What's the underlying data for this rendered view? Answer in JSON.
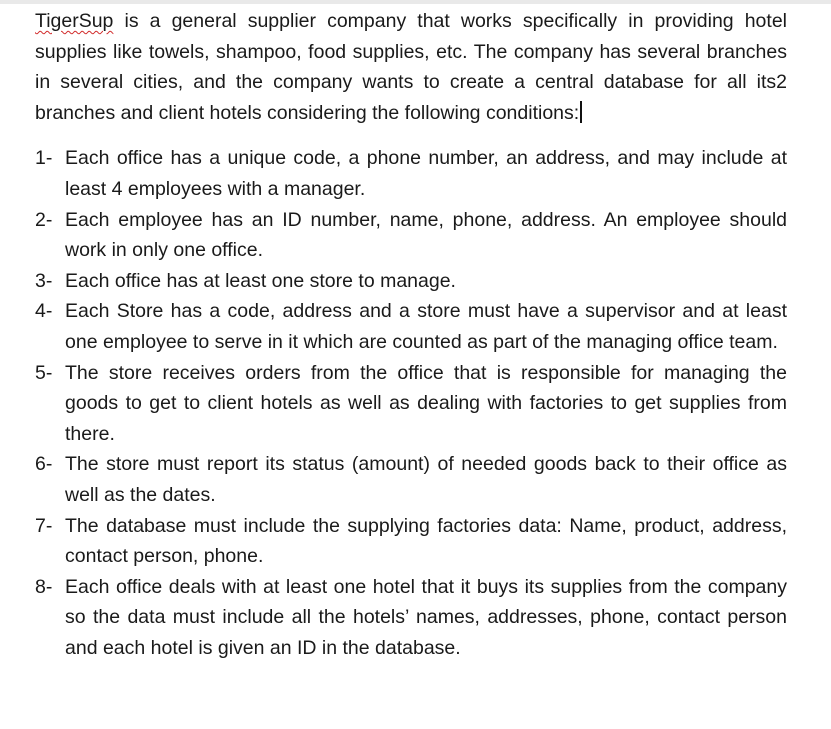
{
  "intro": {
    "brand": "TigerSup",
    "rest": " is a general supplier company that works specifically in providing hotel supplies like towels, shampoo, food supplies, etc. The company has several branches in several cities, and the company wants to create a central database for all its2 branches and client hotels considering the following conditions:"
  },
  "conditions": [
    {
      "num": "1-",
      "text": "Each office has a unique code, a phone number, an address, and may include at least 4 employees with a manager."
    },
    {
      "num": "2-",
      "text": "Each employee has an ID number, name, phone, address. An employee should work in only one office."
    },
    {
      "num": "3-",
      "text": "Each office has at least one store to manage."
    },
    {
      "num": "4-",
      "text": "Each Store has a code, address and a store must have a supervisor and at least one employee to serve in it which are counted as part of the managing office team."
    },
    {
      "num": "5-",
      "text": "The store receives orders from the office that is responsible for managing the goods to get to client hotels as well as dealing with factories to get supplies from there."
    },
    {
      "num": "6-",
      "text": "The store must report its status (amount) of needed goods back to their office as well as the dates."
    },
    {
      "num": "7-",
      "text": "The database must include the supplying factories data: Name, product, address, contact person, phone."
    },
    {
      "num": "8-",
      "text": "Each office deals with at least one hotel that it buys its supplies from the company so the data must include all the hotels’ names, addresses, phone, contact person and each hotel is given an ID in the database."
    }
  ]
}
